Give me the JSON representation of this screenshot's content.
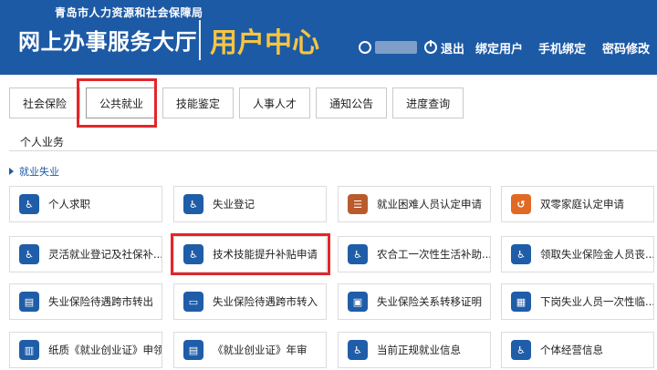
{
  "header": {
    "org_name": "青岛市人力资源和社会保障局",
    "hall_name": "网上办事服务大厅",
    "center_name": "用户中心",
    "logout_label": "退出",
    "links": [
      "绑定用户",
      "手机绑定",
      "密码修改"
    ]
  },
  "tabs": [
    "社会保险",
    "公共就业",
    "技能鉴定",
    "人事人才",
    "通知公告",
    "进度查询"
  ],
  "active_tab": "公共就业",
  "section_title": "个人业务",
  "category_title": "就业失业",
  "services": [
    {
      "label": "个人求职",
      "icon": "walker-icon"
    },
    {
      "label": "失业登记",
      "icon": "walker-icon"
    },
    {
      "label": "就业困难人员认定申请",
      "icon": "form-icon"
    },
    {
      "label": "双零家庭认定申请",
      "icon": "refresh-icon"
    },
    {
      "label": "灵活就业登记及社保补...",
      "icon": "walker-icon"
    },
    {
      "label": "技术技能提升补贴申请",
      "icon": "walker-icon"
    },
    {
      "label": "农合工一次性生活补助...",
      "icon": "walker-icon"
    },
    {
      "label": "领取失业保险金人员丧...",
      "icon": "walker-icon"
    },
    {
      "label": "失业保险待遇跨市转出",
      "icon": "doc-icon"
    },
    {
      "label": "失业保险待遇跨市转入",
      "icon": "ticket-icon"
    },
    {
      "label": "失业保险关系转移证明",
      "icon": "certificate-icon"
    },
    {
      "label": "下岗失业人员一次性临...",
      "icon": "id-card-icon"
    },
    {
      "label": "纸质《就业创业证》申领",
      "icon": "book-icon"
    },
    {
      "label": "《就业创业证》年审",
      "icon": "doc-icon"
    },
    {
      "label": "当前正规就业信息",
      "icon": "walker-icon"
    },
    {
      "label": "个体经营信息",
      "icon": "walker-icon"
    }
  ],
  "colors": {
    "brand_blue": "#1d5aa5",
    "highlight_red": "#e3262b",
    "title_gold": "#f5c542"
  }
}
